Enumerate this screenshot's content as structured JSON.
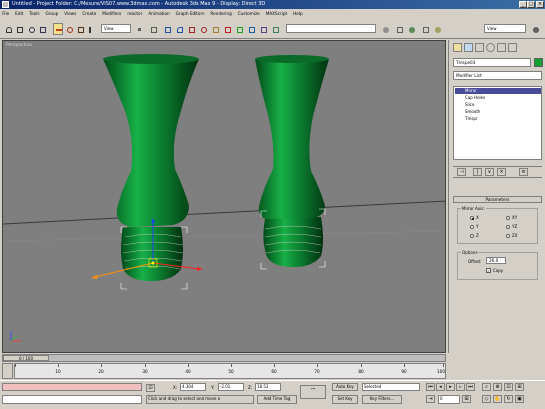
{
  "window": {
    "title": "Untitled    - Project Folder: C:/Mesure/VIS07.www.3dmax.com    - Autodesk 3ds Max 9    - Display: Direct 3D"
  },
  "menu": [
    "File",
    "Edit",
    "Tools",
    "Group",
    "Views",
    "Create",
    "Modifiers",
    "reactor",
    "Animation",
    "Graph Editors",
    "Rendering",
    "Customize",
    "MAXScript",
    "Help"
  ],
  "toolbar": {
    "selection_filter": "View",
    "named_selection": "",
    "view_dropdown": "View"
  },
  "viewport": {
    "label": "Perspective"
  },
  "command_panel": {
    "object_name": "Tmspe03",
    "modifier_list": "Modifier List",
    "stack": [
      {
        "label": "Mirror",
        "selected": true
      },
      {
        "label": "Cap Holes",
        "selected": false
      },
      {
        "label": "Slice",
        "selected": false
      },
      {
        "label": "Smooth",
        "selected": false
      },
      {
        "label": "Tmspr",
        "selected": false
      }
    ],
    "rollout_title": "Parameters",
    "mirror_axis": {
      "group_label": "Mirror Axis:",
      "options": [
        "X",
        "Y",
        "Z",
        "XY",
        "YZ",
        "ZX"
      ],
      "selected": "X"
    },
    "options_group": {
      "label": "Options",
      "offset_label": "Offset:",
      "offset_value": "26.0",
      "copy_label": "Copy",
      "copy_checked": true
    }
  },
  "timeline": {
    "slider_label": "0 / 100",
    "ticks": [
      "10",
      "20",
      "30",
      "40",
      "50",
      "60",
      "70",
      "80",
      "90",
      "100"
    ]
  },
  "status": {
    "prompt": "Click and drag to select and move o",
    "x_label": "X:",
    "x_value": "4.304",
    "y_label": "Y:",
    "y_value": "-2.01",
    "z_label": "Z:",
    "z_value": "18.53",
    "add_time_tag": "Add Time Tag",
    "autokey": "Auto Key",
    "setkey": "Set Key",
    "key_mode": "Selected",
    "key_filters": "Key Filters...",
    "frame": "0"
  }
}
